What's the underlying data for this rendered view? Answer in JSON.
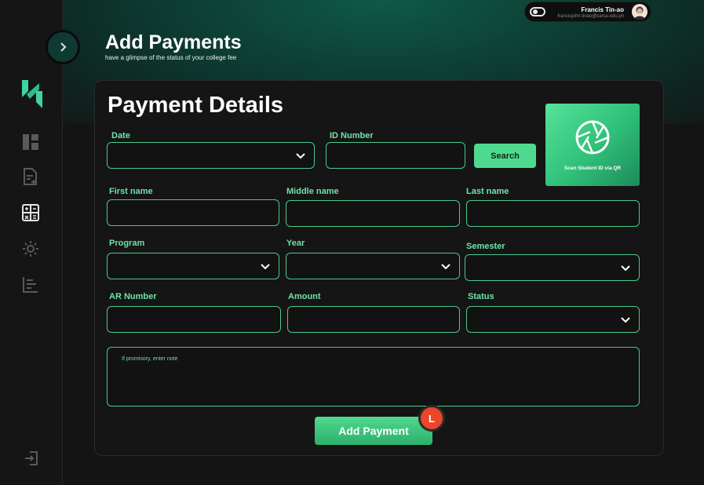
{
  "header": {
    "title": "Add Payments",
    "subtitle": "have a glimpse of the status of your college fee"
  },
  "user": {
    "name": "Francis Tin-ao",
    "email": "francisjohn.tinao@carsu.edu.ph"
  },
  "sidebar": {
    "items": [
      {
        "icon": "dashboard-icon"
      },
      {
        "icon": "document-add-icon"
      },
      {
        "icon": "calculator-icon",
        "active": true
      },
      {
        "icon": "gear-icon"
      },
      {
        "icon": "report-list-icon"
      }
    ],
    "logout_icon": "logout-icon"
  },
  "form": {
    "title": "Payment Details",
    "date_label": "Date",
    "id_label": "ID Number",
    "search_label": "Search",
    "qr_label": "Scan Student ID via QR",
    "first_name_label": "First name",
    "middle_name_label": "Middle name",
    "last_name_label": "Last name",
    "program_label": "Program",
    "year_label": "Year",
    "semester_label": "Semester",
    "ar_label": "AR Number",
    "amount_label": "Amount",
    "status_label": "Status",
    "note_placeholder": "If promisory, enter note",
    "submit_label": "Add Payment"
  },
  "badge": {
    "letter": "L"
  },
  "colors": {
    "accent": "#4fd98e",
    "label": "#6fe3a8",
    "border": "#49c98b",
    "badge": "#e9462a"
  }
}
